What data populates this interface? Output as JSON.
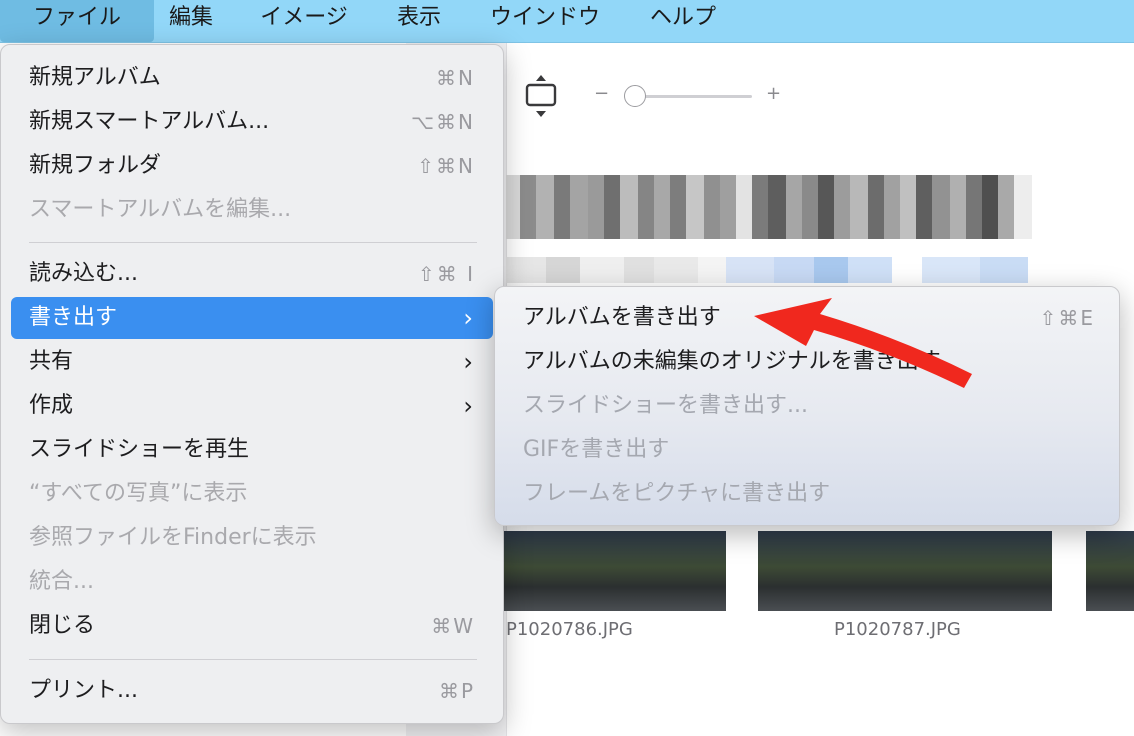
{
  "menubar": {
    "items": [
      {
        "label": "ファイル"
      },
      {
        "label": "編集"
      },
      {
        "label": "イメージ"
      },
      {
        "label": "表示"
      },
      {
        "label": "ウインドウ"
      },
      {
        "label": "ヘルプ"
      }
    ]
  },
  "file_menu": {
    "items": [
      {
        "label": "新規アルバム",
        "shortcut": "⌘N"
      },
      {
        "label": "新規スマートアルバム...",
        "shortcut": "⌥⌘N"
      },
      {
        "label": "新規フォルダ",
        "shortcut": "⇧⌘N"
      },
      {
        "label": "スマートアルバムを編集..."
      },
      {
        "label": "読み込む...",
        "shortcut": "⇧⌘ I"
      },
      {
        "label": "書き出す"
      },
      {
        "label": "共有"
      },
      {
        "label": "作成"
      },
      {
        "label": "スライドショーを再生"
      },
      {
        "label": "“すべての写真”に表示"
      },
      {
        "label": "参照ファイルをFinderに表示"
      },
      {
        "label": "統合..."
      },
      {
        "label": "閉じる",
        "shortcut": "⌘W"
      },
      {
        "label": "プリント...",
        "shortcut": "⌘P"
      }
    ],
    "chevron": "›"
  },
  "export_submenu": {
    "items": [
      {
        "label": "アルバムを書き出す",
        "shortcut": "⇧⌘E"
      },
      {
        "label": "アルバムの未編集のオリジナルを書き出す"
      },
      {
        "label": "スライドショーを書き出す..."
      },
      {
        "label": "GIFを書き出す"
      },
      {
        "label": "フレームをピクチャに書き出す"
      }
    ]
  },
  "toolbar": {
    "zoom_minus": "−",
    "zoom_plus": "+",
    "zoom_level": 0
  },
  "photos": [
    {
      "caption": "P1020786.JPG"
    },
    {
      "caption": "P1020787.JPG"
    }
  ],
  "colors": {
    "menubar_bg": "#92d7f8",
    "highlight": "#3a8ff0",
    "annotation_arrow": "#f0281e"
  },
  "icons": {
    "fit": "fit-to-window-icon",
    "chevron": "chevron-right-icon",
    "annotation": "red-arrow-annotation"
  }
}
